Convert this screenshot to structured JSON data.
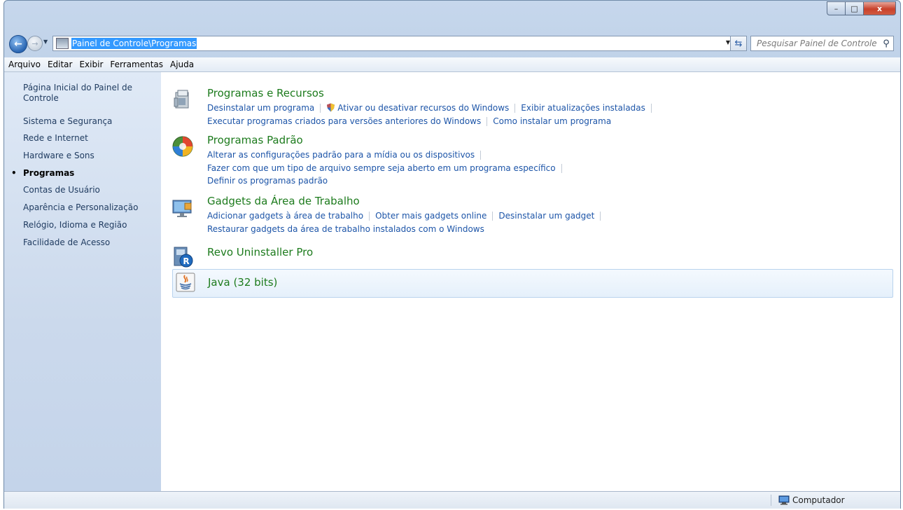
{
  "window": {
    "caption_buttons": {
      "minimize": "–",
      "maximize": "□",
      "close": "x"
    }
  },
  "nav": {
    "back_glyph": "←",
    "forward_glyph": "→",
    "address": "Painel de Controle\\Programas",
    "search_placeholder": "Pesquisar Painel de Controle"
  },
  "menu": [
    "Arquivo",
    "Editar",
    "Exibir",
    "Ferramentas",
    "Ajuda"
  ],
  "sidebar": {
    "items": [
      {
        "label": "Página Inicial do Painel de Controle",
        "active": false
      },
      {
        "label": "Sistema e Segurança",
        "active": false
      },
      {
        "label": "Rede e Internet",
        "active": false
      },
      {
        "label": "Hardware e Sons",
        "active": false
      },
      {
        "label": "Programas",
        "active": true
      },
      {
        "label": "Contas de Usuário",
        "active": false
      },
      {
        "label": "Aparência e Personalização",
        "active": false
      },
      {
        "label": "Relógio, Idioma e Região",
        "active": false
      },
      {
        "label": "Facilidade de Acesso",
        "active": false
      }
    ],
    "bullet": "•"
  },
  "categories": [
    {
      "title": "Programas e Recursos",
      "icon": "programs-features-icon",
      "links": [
        [
          "Desinstalar um programa",
          "Ativar ou desativar recursos do Windows",
          "Exibir atualizações instaladas"
        ],
        [
          "Executar programas criados para versões anteriores do Windows",
          "Como instalar um programa"
        ]
      ]
    },
    {
      "title": "Programas Padrão",
      "icon": "default-programs-icon",
      "links": [
        [
          "Alterar as configurações padrão para a mídia ou os dispositivos"
        ],
        [
          "Fazer com que um tipo de arquivo sempre seja aberto em um programa específico"
        ],
        [
          "Definir os programas padrão"
        ]
      ]
    },
    {
      "title": "Gadgets da Área de Trabalho",
      "icon": "desktop-gadgets-icon",
      "links": [
        [
          "Adicionar gadgets à área de trabalho",
          "Obter mais gadgets online",
          "Desinstalar um gadget"
        ],
        [
          "Restaurar gadgets da área de trabalho instalados com o Windows"
        ]
      ]
    },
    {
      "title": "Revo Uninstaller Pro",
      "icon": "revo-uninstaller-icon",
      "links": []
    },
    {
      "title": "Java (32 bits)",
      "icon": "java-icon",
      "links": []
    }
  ],
  "status": {
    "zone": "Computador"
  },
  "colors": {
    "link": "#1d55a8",
    "category_title": "#1d7b1d",
    "selection": "#3399ff"
  }
}
